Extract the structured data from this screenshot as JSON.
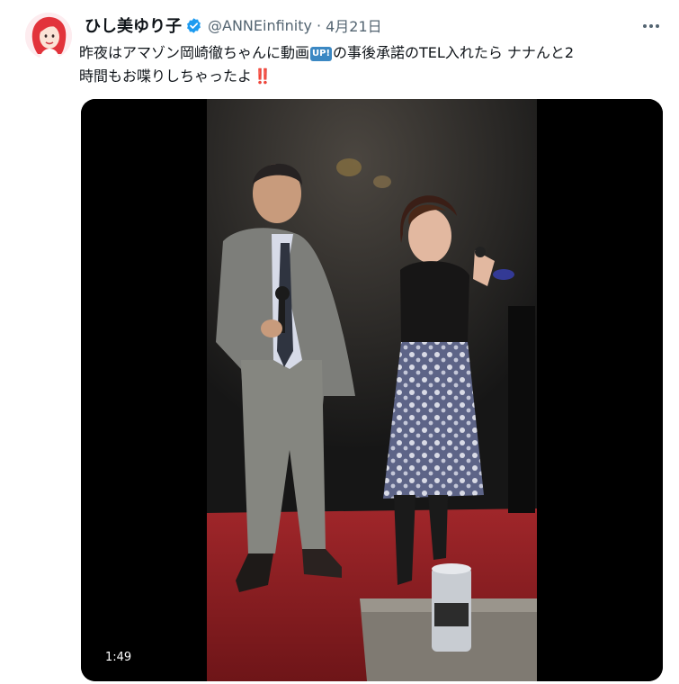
{
  "tweet": {
    "display_name": "ひし美ゆり子",
    "handle": "@ANNEinfinity",
    "separator": "·",
    "timestamp": "4月21日",
    "text_line1_a": "昨夜はアマゾン岡崎徹ちゃんに動画",
    "up_emoji": "UP!",
    "text_line1_b": "の事後承諾のTEL入れたら ナナんと2",
    "text_line2": "時間もお喋りしちゃったよ",
    "text_emoji": "‼️"
  },
  "media": {
    "type": "video",
    "duration": "1:49"
  },
  "icons": {
    "verified": "verified-badge-icon",
    "more": "more-options-icon"
  },
  "colors": {
    "text": "#0f1419",
    "secondary": "#536471",
    "verified": "#1d9bf0",
    "media_bg": "#000000"
  }
}
